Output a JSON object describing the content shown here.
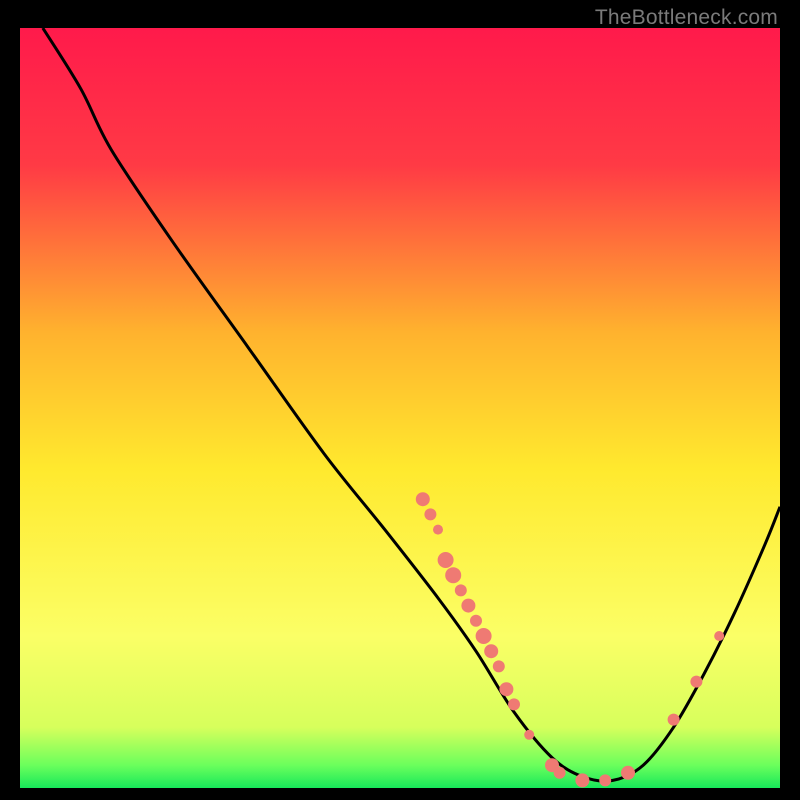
{
  "watermark": "TheBottleneck.com",
  "chart_data": {
    "type": "line",
    "title": "",
    "xlabel": "",
    "ylabel": "",
    "xlim": [
      0,
      100
    ],
    "ylim": [
      0,
      100
    ],
    "grid": false,
    "legend": false,
    "gradient_stops": [
      {
        "offset": 0,
        "color": "#ff1a4b"
      },
      {
        "offset": 18,
        "color": "#ff3a45"
      },
      {
        "offset": 40,
        "color": "#ffb22e"
      },
      {
        "offset": 58,
        "color": "#ffe92e"
      },
      {
        "offset": 80,
        "color": "#fbff66"
      },
      {
        "offset": 92,
        "color": "#d7ff5c"
      },
      {
        "offset": 97,
        "color": "#6bff5c"
      },
      {
        "offset": 100,
        "color": "#17e85a"
      }
    ],
    "curve": {
      "comment": "Main black curve: y is percent from top (0) to bottom (100).",
      "points": [
        {
          "x": 3,
          "y": 0
        },
        {
          "x": 8,
          "y": 8
        },
        {
          "x": 12,
          "y": 16
        },
        {
          "x": 20,
          "y": 28
        },
        {
          "x": 30,
          "y": 42
        },
        {
          "x": 40,
          "y": 56
        },
        {
          "x": 48,
          "y": 66
        },
        {
          "x": 55,
          "y": 75
        },
        {
          "x": 60,
          "y": 82
        },
        {
          "x": 65,
          "y": 90
        },
        {
          "x": 70,
          "y": 96
        },
        {
          "x": 74,
          "y": 98.5
        },
        {
          "x": 78,
          "y": 99
        },
        {
          "x": 82,
          "y": 97
        },
        {
          "x": 86,
          "y": 92
        },
        {
          "x": 90,
          "y": 85
        },
        {
          "x": 94,
          "y": 77
        },
        {
          "x": 98,
          "y": 68
        },
        {
          "x": 100,
          "y": 63
        }
      ]
    },
    "markers": {
      "comment": "Salmon-colored circular markers scattered along/near the curve.",
      "color": "#ef7a73",
      "radius_small": 5,
      "radius_large": 8,
      "points": [
        {
          "x": 53,
          "y": 62,
          "r": 7
        },
        {
          "x": 54,
          "y": 64,
          "r": 6
        },
        {
          "x": 55,
          "y": 66,
          "r": 5
        },
        {
          "x": 56,
          "y": 70,
          "r": 8
        },
        {
          "x": 57,
          "y": 72,
          "r": 8
        },
        {
          "x": 58,
          "y": 74,
          "r": 6
        },
        {
          "x": 59,
          "y": 76,
          "r": 7
        },
        {
          "x": 60,
          "y": 78,
          "r": 6
        },
        {
          "x": 61,
          "y": 80,
          "r": 8
        },
        {
          "x": 62,
          "y": 82,
          "r": 7
        },
        {
          "x": 63,
          "y": 84,
          "r": 6
        },
        {
          "x": 64,
          "y": 87,
          "r": 7
        },
        {
          "x": 65,
          "y": 89,
          "r": 6
        },
        {
          "x": 67,
          "y": 93,
          "r": 5
        },
        {
          "x": 70,
          "y": 97,
          "r": 7
        },
        {
          "x": 71,
          "y": 98,
          "r": 6
        },
        {
          "x": 74,
          "y": 99,
          "r": 7
        },
        {
          "x": 77,
          "y": 99,
          "r": 6
        },
        {
          "x": 80,
          "y": 98,
          "r": 7
        },
        {
          "x": 86,
          "y": 91,
          "r": 6
        },
        {
          "x": 89,
          "y": 86,
          "r": 6
        },
        {
          "x": 92,
          "y": 80,
          "r": 5
        }
      ]
    }
  }
}
